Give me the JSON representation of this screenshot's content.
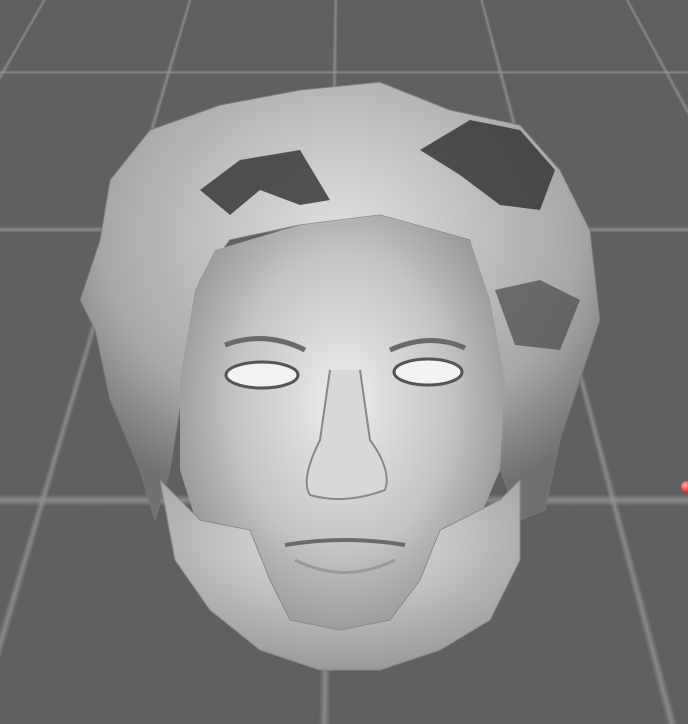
{
  "viewport": {
    "background_color": "#606060",
    "grid_color": "#969696",
    "model": {
      "type": "3d-head-mesh",
      "color": "#c8c8c8"
    },
    "marker": {
      "color": "#e03030"
    }
  }
}
